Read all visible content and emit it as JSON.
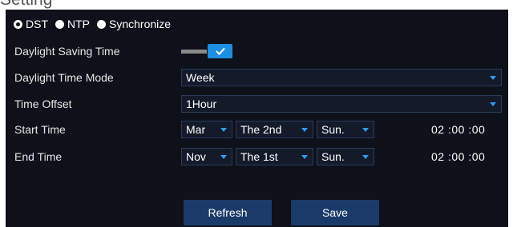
{
  "header": {
    "partial_title": "Setting"
  },
  "time_source": {
    "options": [
      {
        "label": "DST",
        "selected": true
      },
      {
        "label": "NTP",
        "selected": false
      },
      {
        "label": "Synchronize",
        "selected": false
      }
    ]
  },
  "daylight_saving": {
    "label": "Daylight Saving Time",
    "enabled": true
  },
  "mode": {
    "label": "Daylight Time Mode",
    "value": "Week"
  },
  "offset": {
    "label": "Time Offset",
    "value": "1Hour"
  },
  "start": {
    "label": "Start Time",
    "month": "Mar",
    "week": "The 2nd",
    "day": "Sun.",
    "time": "02 :00 :00"
  },
  "end": {
    "label": "End Time",
    "month": "Nov",
    "week": "The 1st",
    "day": "Sun.",
    "time": "02 :00 :00"
  },
  "buttons": {
    "refresh": "Refresh",
    "save": "Save"
  },
  "colors": {
    "panel_bg": "#0e1119",
    "accent": "#1e8ee0",
    "button_bg": "#1a3a6a"
  }
}
